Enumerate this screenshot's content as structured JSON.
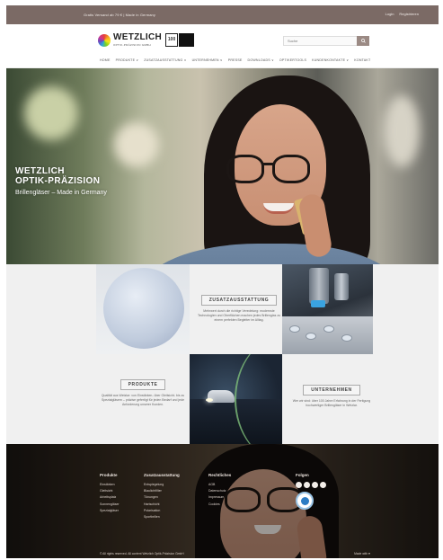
{
  "topbar": {
    "info": "Gratis Versand ab 79 € | Made in Germany",
    "login": "Login",
    "register": "Registrieren"
  },
  "header": {
    "logo_name": "WETZLICH",
    "logo_sub": "OPTIK-PRÄZISION GMBH",
    "badge": "100",
    "search_placeholder": "Suche"
  },
  "nav": {
    "items": [
      "Home",
      "Produkte ∨",
      "Zusatzausstattung ∨",
      "Unternehmen ∨",
      "Presse",
      "Downloads ∨",
      "Optikertools",
      "Kundenkontakte ∨",
      "Kontakt"
    ]
  },
  "hero": {
    "title_line1": "WETZLICH",
    "title_line2": "OPTIK-PRÄZISION",
    "subtitle": "Brillengläser – Made in Germany"
  },
  "tiles": {
    "zusatz_title": "ZUSATZAUSSTATTUNG",
    "zusatz_text": "Mehrwert durch die richtige Veredelung: modernste Technologien und Oberflächen machen jedes Brillenglas zu einem perfekten Begleiter im Alltag.",
    "produkte_title": "PRODUKTE",
    "produkte_text": "Qualität aus Wetzlar: von Einstärken- über Gleitsicht- bis zu Spezialgläsern – präzise gefertigt für jeden Bedarf und jede Anforderung unserer Kunden.",
    "unternehmen_title": "UNTERNEHMEN",
    "unternehmen_text": "Wer wir sind: über 100 Jahre Erfahrung in der Fertigung hochwertiger Brillengläser in Wetzlar."
  },
  "footer": {
    "col1_title": "Produkte",
    "col1_items": [
      "Einstärken",
      "Gleitsicht",
      "Arbeitsplatz",
      "Sonnengläser",
      "Spezialgläser"
    ],
    "col2_title": "Zusatzausstattung",
    "col2_items": [
      "Entspiegelung",
      "Blaulichtfilter",
      "Tönungen",
      "Hartschicht",
      "Polarisation",
      "Sportbrillen"
    ],
    "col3_title": "Rechtliches",
    "col3_items": [
      "AGB",
      "Datenschutz",
      "Impressum",
      "Cookies"
    ],
    "col4_title": "Folgen",
    "copyright": "© All rights reserved. All content Wetzlich Optik-Präzision GmbH",
    "made_in": "Made with ♥"
  },
  "colors": {
    "topbar": "#7b6a65",
    "accent": "#9b8a84"
  }
}
